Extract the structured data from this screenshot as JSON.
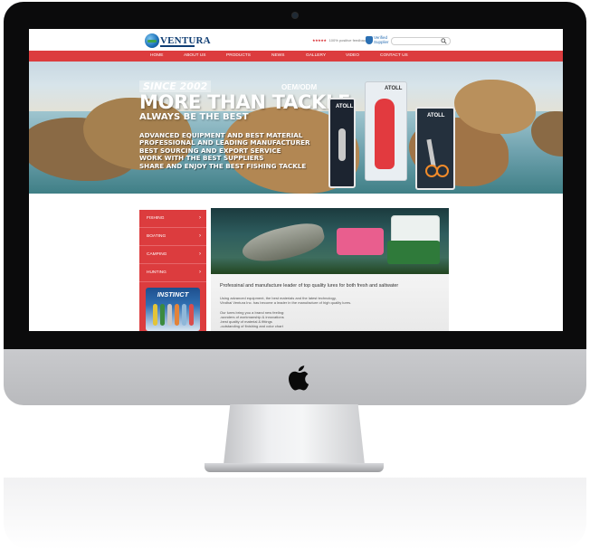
{
  "site": {
    "logo_text": "VENTURA",
    "rating_stars": "★★★★★",
    "rating_text": "100% positive feedback",
    "verified_line1": "Verified",
    "verified_line2": "Supplier",
    "search_placeholder": ""
  },
  "nav": {
    "items": [
      "HOME",
      "ABOUT US",
      "PRODUCTS",
      "NEWS",
      "GALLERY",
      "VIDEO",
      "CONTACT US"
    ]
  },
  "banner": {
    "since": "SINCE 2002",
    "oem": "OEM/ODM",
    "headline": "MORE THAN TACKLE",
    "subheadline": "ALWAYS BE THE BEST",
    "lines": [
      "ADVANCED EQUIPMENT AND BEST MATERIAL",
      "PROFESSIONAL AND LEADING MANUFACTURER",
      "BEST SOURCING AND EXPORT SERVICE",
      "WORK WITH THE BEST SUPPLIERS",
      "SHARE AND ENJOY THE BEST FISHING TACKLE"
    ],
    "product_brand": "ATOLL",
    "slides_total": 3,
    "slide_active": 2
  },
  "sidebar": {
    "items": [
      "FISHING",
      "BOATING",
      "CAMPING",
      "HUNTING"
    ],
    "product_title": "INSTINCT"
  },
  "content": {
    "title": "Professinal and manufacture leader of top quality lures for both fresh and saltwater",
    "paragraph1_line1": "Using advanced equipment, the best materials and the latest technology,",
    "paragraph1_line2": "Vindhai Ventura Inc. has become a leader in the manufacture of high quality lures.",
    "paragraph2_line1": "Our lures bring you a brand new feeling:",
    "paragraph2_line2": "-wonders of workmanship & innovations",
    "paragraph2_line3": "-best quality of material & fittings",
    "paragraph2_line4": "-outstanding of finishing and color chart"
  },
  "colors": {
    "brand_red": "#dc3c3e",
    "logo_blue": "#0f3d73",
    "bezel": "#0b0b0c",
    "aluminum": "#dcdde0"
  }
}
